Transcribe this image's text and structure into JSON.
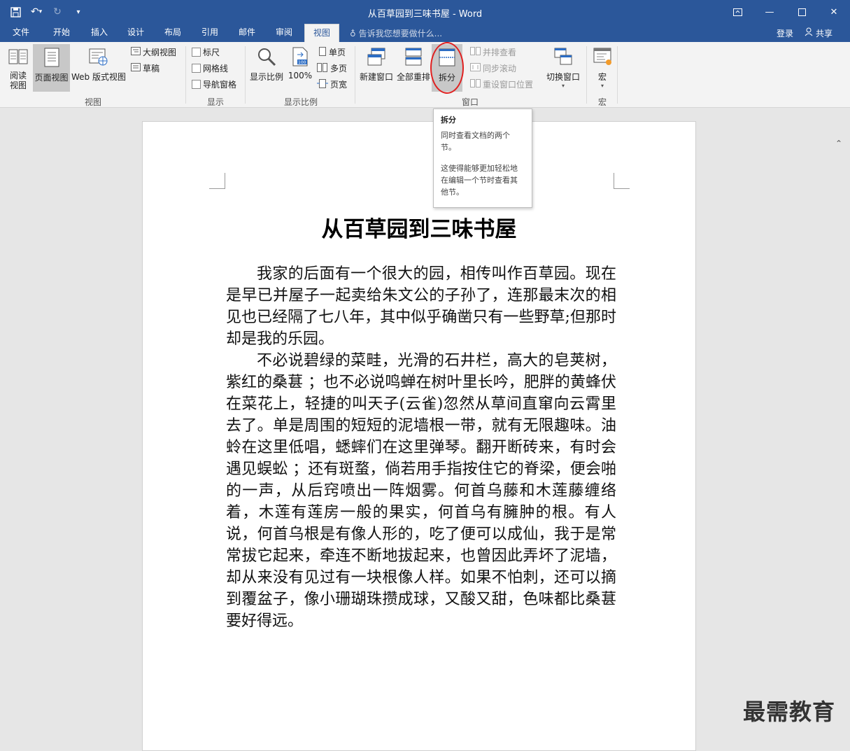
{
  "window": {
    "title": "从百草园到三味书屋 - Word"
  },
  "qat": {
    "save_icon": "save-icon",
    "undo_icon": "undo-icon",
    "redo_icon": "redo-icon",
    "customize_icon": "customize-icon"
  },
  "tabs": [
    "文件",
    "开始",
    "插入",
    "设计",
    "布局",
    "引用",
    "邮件",
    "审阅",
    "视图"
  ],
  "active_tab": "视图",
  "tellme": "告诉我您想要做什么...",
  "account": {
    "login": "登录",
    "share": "共享"
  },
  "ribbon": {
    "views": {
      "read": "阅读视图",
      "print": "页面视图",
      "web": "Web 版式视图",
      "outline": "大纲视图",
      "draft": "草稿",
      "group": "视图"
    },
    "show": {
      "ruler": "标尺",
      "gridlines": "网格线",
      "nav": "导航窗格",
      "group": "显示"
    },
    "zoom": {
      "zoom": "显示比例",
      "hundred": "100%",
      "one": "单页",
      "multi": "多页",
      "width": "页宽",
      "group": "显示比例"
    },
    "window": {
      "new": "新建窗口",
      "arrange": "全部重排",
      "split": "拆分",
      "side": "并排查看",
      "sync": "同步滚动",
      "reset": "重设窗口位置",
      "switch": "切换窗口",
      "group": "窗口"
    },
    "macro": {
      "macro": "宏",
      "group": "宏"
    }
  },
  "tooltip": {
    "title": "拆分",
    "p1": "同时查看文档的两个节。",
    "p2": "这使得能够更加轻松地在编辑一个节时查看其他节。"
  },
  "doc": {
    "title": "从百草园到三味书屋",
    "p1": "我家的后面有一个很大的园，相传叫作百草园。现在是早已并屋子一起卖给朱文公的子孙了，连那最末次的相见也已经隔了七八年，其中似乎确凿只有一些野草;但那时却是我的乐园。",
    "p2": "不必说碧绿的菜畦，光滑的石井栏，高大的皂荚树，紫红的桑葚 ；也不必说鸣蝉在树叶里长吟，肥胖的黄蜂伏在菜花上，轻捷的叫天子(云雀)忽然从草间直窜向云霄里去了。单是周围的短短的泥墙根一带，就有无限趣味。油蛉在这里低唱，蟋蟀们在这里弹琴。翻开断砖来，有时会遇见蜈蚣 ；还有斑蝥，倘若用手指按住它的脊梁，便会啪的一声，从后窍喷出一阵烟雾。何首乌藤和木莲藤缠络着，木莲有莲房一般的果实，何首乌有臃肿的根。有人说，何首乌根是有像人形的，吃了便可以成仙，我于是常常拔它起来，牵连不断地拔起来，也曾因此弄坏了泥墙，却从来没有见过有一块根像人样。如果不怕刺，还可以摘到覆盆子，像小珊瑚珠攒成球，又酸又甜，色味都比桑葚要好得远。"
  },
  "watermark": "最需教育",
  "colors": {
    "brand": "#2b579a",
    "highlight": "#e02020"
  }
}
